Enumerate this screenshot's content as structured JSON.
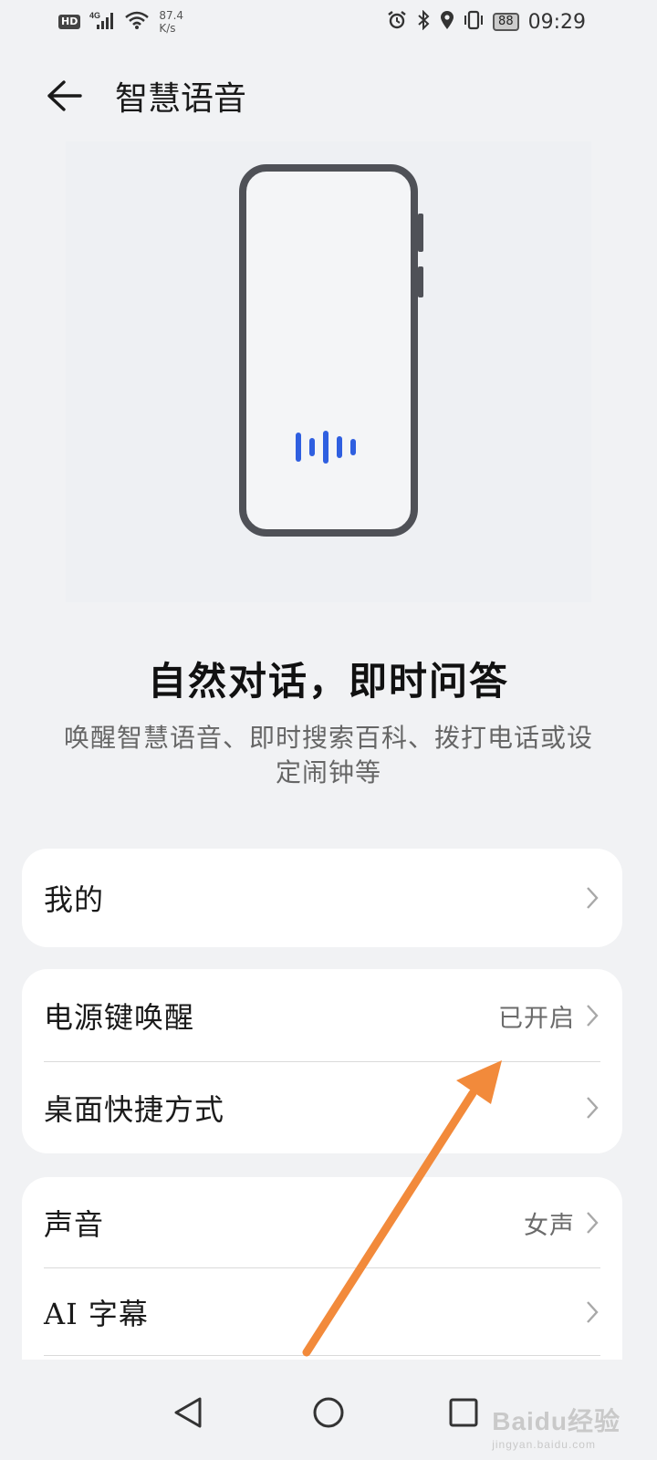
{
  "status_bar": {
    "hd": "HD",
    "network": "4G",
    "speed_value": "87.4",
    "speed_unit": "K/s",
    "battery": "88",
    "time": "09:29",
    "icons": [
      "signal-icon",
      "wifi-icon",
      "alarm-icon",
      "bluetooth-icon",
      "location-icon",
      "vibrate-icon",
      "battery-icon"
    ]
  },
  "header": {
    "title": "智慧语音"
  },
  "hero": {
    "title": "自然对话，即时问答",
    "subtitle": "唤醒智慧语音、即时搜索百科、拨打电话或设定闹钟等"
  },
  "sections": [
    {
      "rows": [
        {
          "label": "我的",
          "value": ""
        }
      ]
    },
    {
      "rows": [
        {
          "label": "电源键唤醒",
          "value": "已开启"
        },
        {
          "label": "桌面快捷方式",
          "value": ""
        }
      ]
    },
    {
      "rows": [
        {
          "label": "声音",
          "value": "女声"
        },
        {
          "label": "AI 字幕",
          "value": ""
        }
      ]
    }
  ],
  "nav": {
    "icons": [
      "back-triangle-icon",
      "home-circle-icon",
      "recents-square-icon"
    ]
  },
  "watermark": {
    "main": "Baidu经验",
    "sub": "jingyan.baidu.com"
  },
  "colors": {
    "background": "#f1f2f4",
    "card": "#ffffff",
    "accent_voice": "#2f5fe0",
    "annotation_arrow": "#f28a3b"
  }
}
